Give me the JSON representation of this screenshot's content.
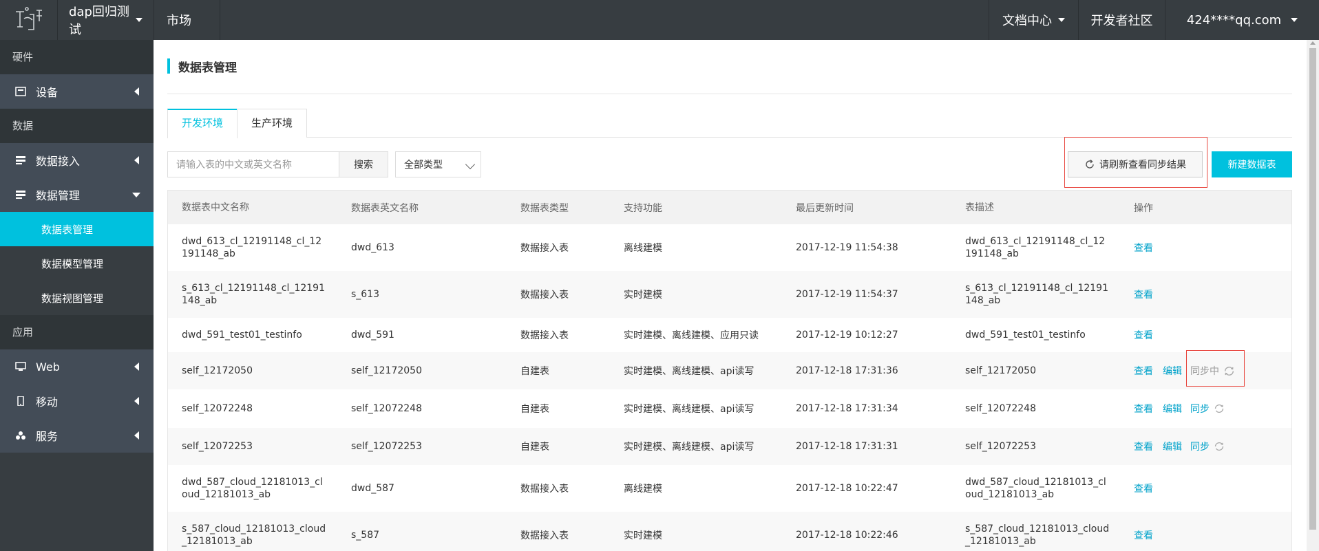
{
  "topbar": {
    "project": "dap回归测试",
    "market": "市场",
    "docs": "文档中心",
    "community": "开发者社区",
    "account": "424****qq.com"
  },
  "sidebar": {
    "groups": [
      "硬件",
      "数据",
      "应用"
    ],
    "device": "设备",
    "data_ingest": "数据接入",
    "data_manage": "数据管理",
    "sub_table": "数据表管理",
    "sub_model": "数据模型管理",
    "sub_view": "数据视图管理",
    "web": "Web",
    "mobile": "移动",
    "service": "服务"
  },
  "page": {
    "title": "数据表管理",
    "tabs": [
      "开发环境",
      "生产环境"
    ],
    "search_placeholder": "请输入表的中文或英文名称",
    "search_button": "搜索",
    "type_select": "全部类型",
    "refresh_button": "请刷新查看同步结果",
    "new_button": "新建数据表"
  },
  "table": {
    "headers": [
      "数据表中文名称",
      "数据表英文名称",
      "数据表类型",
      "支持功能",
      "最后更新时间",
      "表描述",
      "操作"
    ],
    "rows": [
      {
        "cn": "dwd_613_cl_12191148_cl_12191148_ab",
        "en": "dwd_613",
        "type": "数据接入表",
        "func": "离线建模",
        "time": "2017-12-19 11:54:38",
        "desc": "dwd_613_cl_12191148_cl_12191148_ab",
        "view": "查看"
      },
      {
        "cn": "s_613_cl_12191148_cl_12191148_ab",
        "en": "s_613",
        "type": "数据接入表",
        "func": "实时建模",
        "time": "2017-12-19 11:54:37",
        "desc": "s_613_cl_12191148_cl_12191148_ab",
        "view": "查看"
      },
      {
        "cn": "dwd_591_test01_testinfo",
        "en": "dwd_591",
        "type": "数据接入表",
        "func": "实时建模、离线建模、应用只读",
        "time": "2017-12-19 10:12:27",
        "desc": "dwd_591_test01_testinfo",
        "view": "查看"
      },
      {
        "cn": "self_12172050",
        "en": "self_12172050",
        "type": "自建表",
        "func": "实时建模、离线建模、api读写",
        "time": "2017-12-18 17:31:36",
        "desc": "self_12172050",
        "view": "查看",
        "edit": "编辑",
        "sync": "同步中"
      },
      {
        "cn": "self_12072248",
        "en": "self_12072248",
        "type": "自建表",
        "func": "实时建模、离线建模、api读写",
        "time": "2017-12-18 17:31:34",
        "desc": "self_12072248",
        "view": "查看",
        "edit": "编辑",
        "sync": "同步"
      },
      {
        "cn": "self_12072253",
        "en": "self_12072253",
        "type": "自建表",
        "func": "实时建模、离线建模、api读写",
        "time": "2017-12-18 17:31:31",
        "desc": "self_12072253",
        "view": "查看",
        "edit": "编辑",
        "sync": "同步"
      },
      {
        "cn": "dwd_587_cloud_12181013_cloud_12181013_ab",
        "en": "dwd_587",
        "type": "数据接入表",
        "func": "离线建模",
        "time": "2017-12-18 10:22:47",
        "desc": "dwd_587_cloud_12181013_cloud_12181013_ab",
        "view": "查看"
      },
      {
        "cn": "s_587_cloud_12181013_cloud_12181013_ab",
        "en": "s_587",
        "type": "数据接入表",
        "func": "实时建模",
        "time": "2017-12-18 10:22:46",
        "desc": "s_587_cloud_12181013_cloud_12181013_ab",
        "view": "查看"
      }
    ]
  },
  "colors": {
    "accent": "#00c1de",
    "link": "#00a2ca",
    "highlight": "#e8473f",
    "dark": "#373d41"
  }
}
